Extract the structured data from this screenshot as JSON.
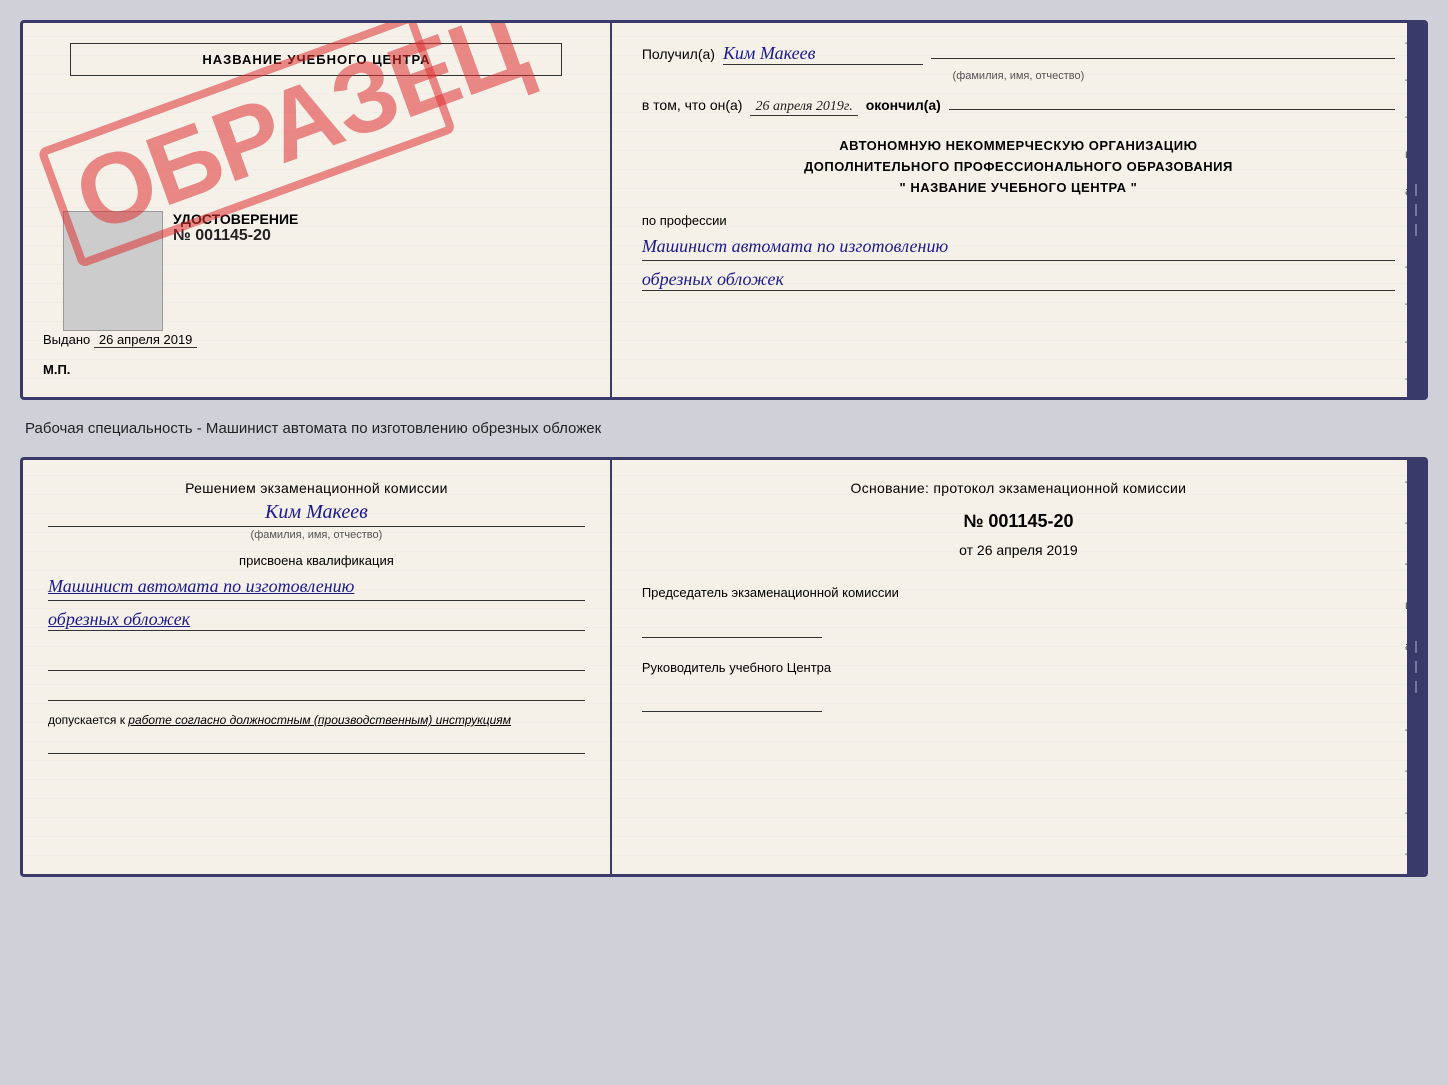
{
  "cert_top": {
    "left": {
      "title_box": "НАЗВАНИЕ УЧЕБНОГО ЦЕНТРА",
      "udostoverenie_label": "УДОСТОВЕРЕНИЕ",
      "number": "№ 001145-20",
      "vydano_label": "Выдано",
      "vydano_date": "26 апреля 2019",
      "mp_label": "М.П.",
      "obrazets": "ОБРАЗЕЦ"
    },
    "right": {
      "poluchil_label": "Получил(а)",
      "poluchil_name": "Ким Макеев",
      "famname_label": "(фамилия, имя, отчество)",
      "v_tom_label": "в том, что он(а)",
      "v_tom_date": "26 апреля 2019г.",
      "okonchil_label": "окончил(а)",
      "org_line1": "АВТОНОМНУЮ НЕКОММЕРЧЕСКУЮ ОРГАНИЗАЦИЮ",
      "org_line2": "ДОПОЛНИТЕЛЬНОГО ПРОФЕССИОНАЛЬНОГО ОБРАЗОВАНИЯ",
      "org_quote1": "\"",
      "org_name": "НАЗВАНИЕ УЧЕБНОГО ЦЕНТРА",
      "org_quote2": "\"",
      "po_professii_label": "по профессии",
      "profession_line1": "Машинист автомата по изготовлению",
      "profession_line2": "обрезных обложек"
    }
  },
  "specialty_label": "Рабочая специальность - Машинист автомата по изготовлению обрезных обложек",
  "cert_bottom": {
    "left": {
      "resheniem_label": "Решением экзаменационной комиссии",
      "name": "Ким Макеев",
      "famname_label": "(фамилия, имя, отчество)",
      "prisvoena_label": "присвоена квалификация",
      "qualification_line1": "Машинист автомата по изготовлению",
      "qualification_line2": "обрезных обложек",
      "dopuskaetsya_prefix": "допускается к",
      "dopuskaetsya_italic": "работе согласно должностным (производственным) инструкциям"
    },
    "right": {
      "osnovanie_label": "Основание: протокол экзаменационной комиссии",
      "protokol_number": "№  001145-20",
      "ot_label": "от",
      "ot_date": "26 апреля 2019",
      "predsedatel_label": "Председатель экзаменационной комиссии",
      "rukovoditel_label": "Руководитель учебного Центра"
    }
  },
  "dashes": {
    "right_side": [
      "–",
      "–",
      "–",
      "и",
      "а",
      "←",
      "–",
      "–",
      "–",
      "–"
    ]
  }
}
